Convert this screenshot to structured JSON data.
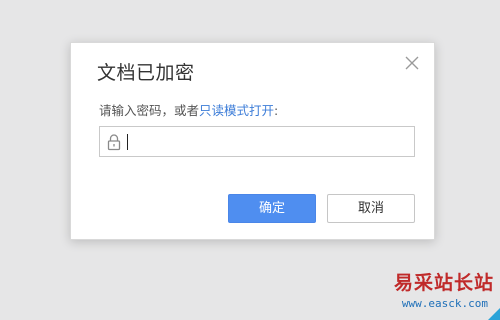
{
  "dialog": {
    "title": "文档已加密",
    "prompt_text": "请输入密码，或者",
    "prompt_link": "只读模式打开",
    "prompt_suffix": ":",
    "password_value": "",
    "ok_label": "确定",
    "cancel_label": "取消"
  },
  "watermark": {
    "title": "易采站长站",
    "url": "www.easck.com"
  },
  "colors": {
    "accent": "#4f8ef0",
    "link": "#3d7dd8",
    "watermark_red": "#c02a2a",
    "watermark_blue": "#1e6fb8"
  },
  "icons": [
    "close-icon",
    "lock-icon"
  ]
}
